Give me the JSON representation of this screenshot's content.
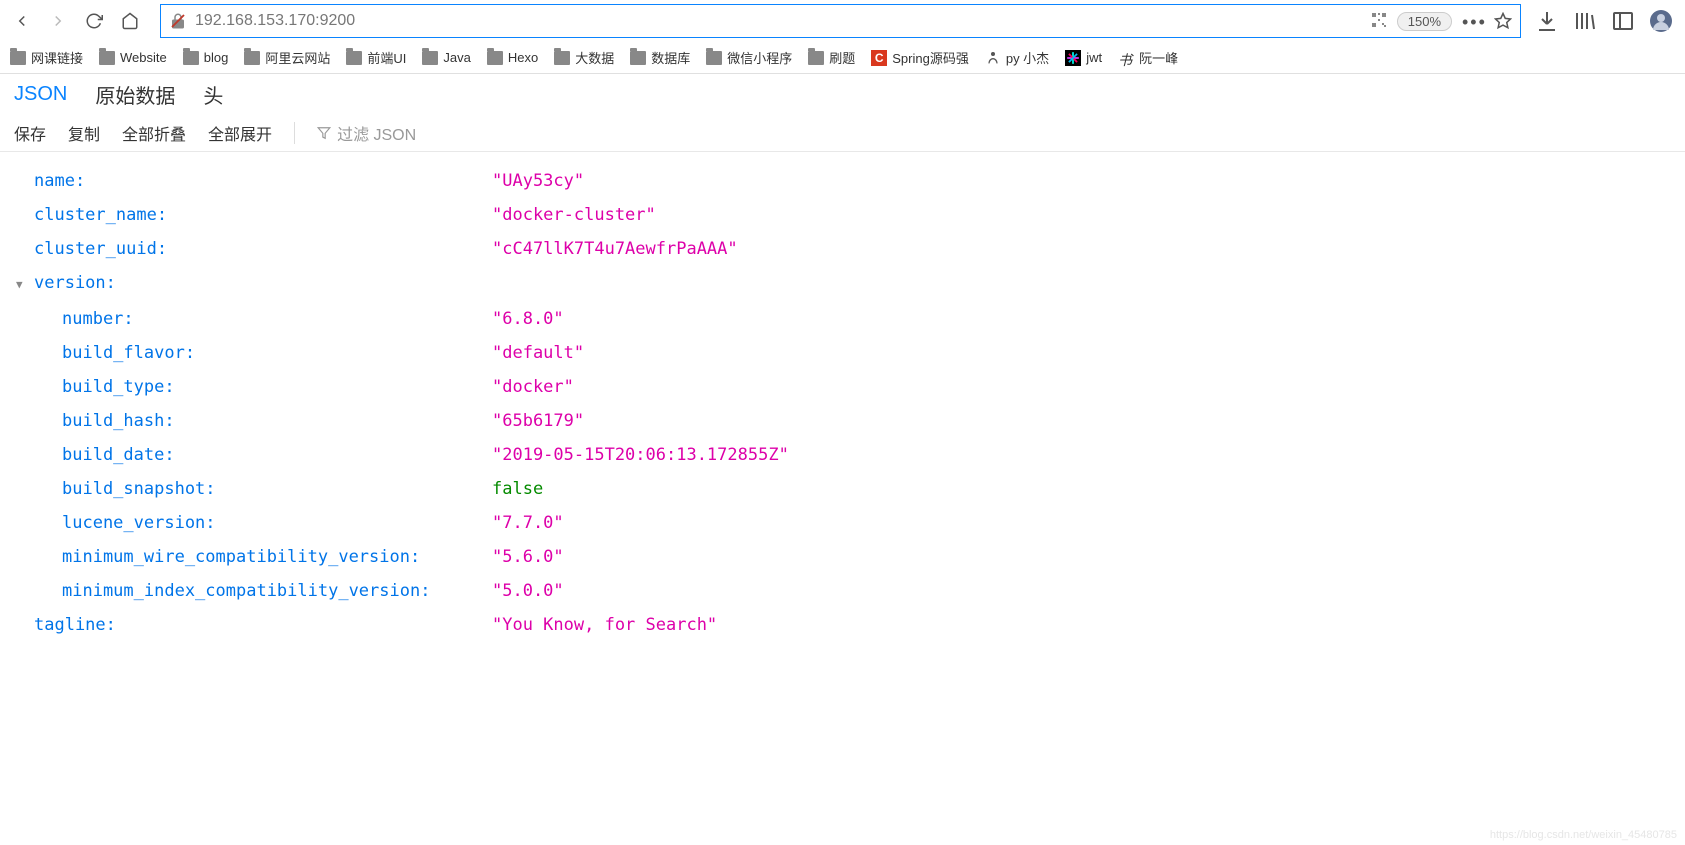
{
  "nav": {
    "url": "192.168.153.170:9200",
    "zoom": "150%"
  },
  "bookmarks": [
    {
      "label": "网课链接",
      "icon": "folder"
    },
    {
      "label": "Website",
      "icon": "folder"
    },
    {
      "label": "blog",
      "icon": "folder"
    },
    {
      "label": "阿里云网站",
      "icon": "folder"
    },
    {
      "label": "前端UI",
      "icon": "folder"
    },
    {
      "label": "Java",
      "icon": "folder"
    },
    {
      "label": "Hexo",
      "icon": "folder"
    },
    {
      "label": "大数据",
      "icon": "folder"
    },
    {
      "label": "数据库",
      "icon": "folder"
    },
    {
      "label": "微信小程序",
      "icon": "folder"
    },
    {
      "label": "刷题",
      "icon": "folder"
    },
    {
      "label": "Spring源码强",
      "icon": "c"
    },
    {
      "label": "py 小杰",
      "icon": "py"
    },
    {
      "label": "jwt",
      "icon": "jwt"
    },
    {
      "label": "阮一峰",
      "icon": "calli"
    }
  ],
  "tabs": [
    {
      "label": "JSON",
      "active": true
    },
    {
      "label": "原始数据",
      "active": false
    },
    {
      "label": "头",
      "active": false
    }
  ],
  "actions": {
    "save": "保存",
    "copy": "复制",
    "collapse_all": "全部折叠",
    "expand_all": "全部展开",
    "filter_placeholder": "过滤 JSON"
  },
  "json": [
    {
      "key": "name",
      "value": "\"UAy53cy\"",
      "type": "str",
      "indent": 1
    },
    {
      "key": "cluster_name",
      "value": "\"docker-cluster\"",
      "type": "str",
      "indent": 1
    },
    {
      "key": "cluster_uuid",
      "value": "\"cC47llK7T4u7AewfrPaAAA\"",
      "type": "str",
      "indent": 1
    },
    {
      "key": "version",
      "value": "",
      "type": "obj",
      "indent": 1,
      "toggle": true
    },
    {
      "key": "number",
      "value": "\"6.8.0\"",
      "type": "str",
      "indent": 2
    },
    {
      "key": "build_flavor",
      "value": "\"default\"",
      "type": "str",
      "indent": 2
    },
    {
      "key": "build_type",
      "value": "\"docker\"",
      "type": "str",
      "indent": 2
    },
    {
      "key": "build_hash",
      "value": "\"65b6179\"",
      "type": "str",
      "indent": 2
    },
    {
      "key": "build_date",
      "value": "\"2019-05-15T20:06:13.172855Z\"",
      "type": "str",
      "indent": 2
    },
    {
      "key": "build_snapshot",
      "value": "false",
      "type": "bool",
      "indent": 2
    },
    {
      "key": "lucene_version",
      "value": "\"7.7.0\"",
      "type": "str",
      "indent": 2
    },
    {
      "key": "minimum_wire_compatibility_version",
      "value": "\"5.6.0\"",
      "type": "str",
      "indent": 2
    },
    {
      "key": "minimum_index_compatibility_version",
      "value": "\"5.0.0\"",
      "type": "str",
      "indent": 2
    },
    {
      "key": "tagline",
      "value": "\"You Know, for Search\"",
      "type": "str",
      "indent": 1
    }
  ],
  "watermark": "https://blog.csdn.net/weixin_45480785"
}
